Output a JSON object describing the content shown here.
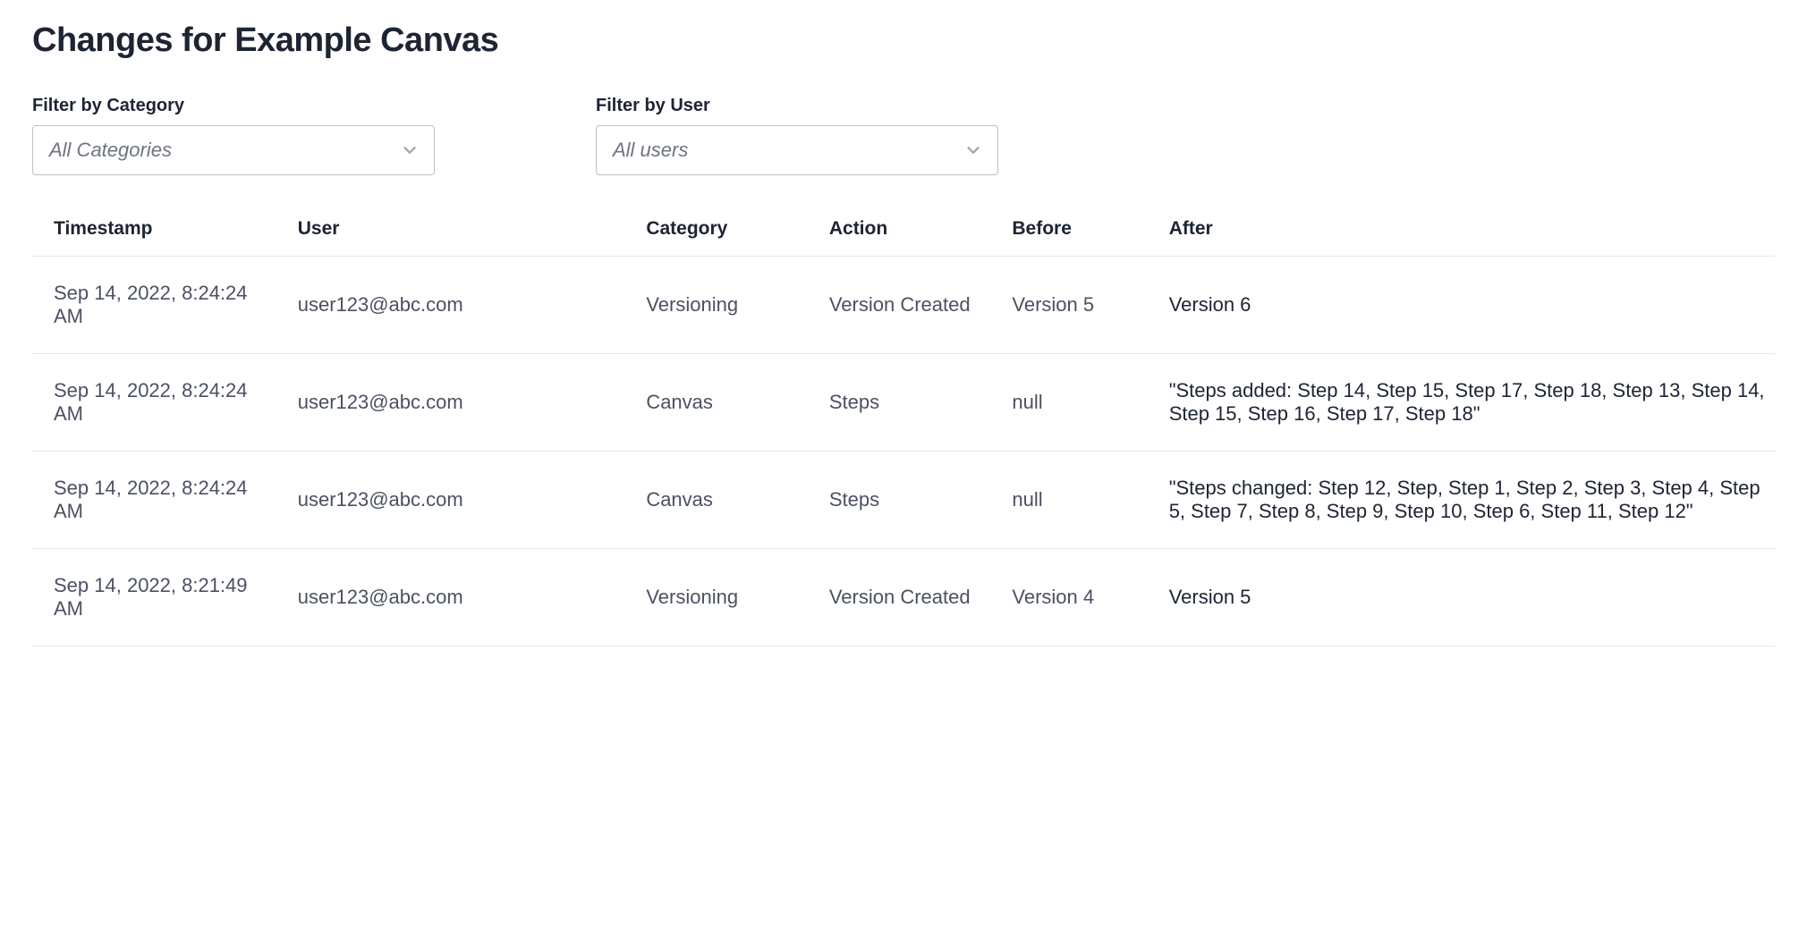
{
  "title": "Changes for Example Canvas",
  "filters": {
    "category": {
      "label": "Filter by Category",
      "placeholder": "All Categories"
    },
    "user": {
      "label": "Filter by User",
      "placeholder": "All users"
    }
  },
  "columns": {
    "timestamp": "Timestamp",
    "user": "User",
    "category": "Category",
    "action": "Action",
    "before": "Before",
    "after": "After"
  },
  "rows": [
    {
      "timestamp": "Sep 14, 2022, 8:24:24 AM",
      "user": "user123@abc.com",
      "category": "Versioning",
      "action": "Version Created",
      "before": "Version 5",
      "after": "Version 6"
    },
    {
      "timestamp": "Sep 14, 2022, 8:24:24 AM",
      "user": "user123@abc.com",
      "category": "Canvas",
      "action": "Steps",
      "before": "null",
      "after": "\"Steps added: Step 14, Step 15, Step 17, Step 18, Step 13, Step 14, Step 15, Step 16, Step 17, Step 18\""
    },
    {
      "timestamp": "Sep 14, 2022, 8:24:24 AM",
      "user": "user123@abc.com",
      "category": "Canvas",
      "action": "Steps",
      "before": "null",
      "after": "\"Steps changed: Step 12, Step, Step 1, Step 2, Step 3, Step 4, Step 5, Step 7, Step 8, Step 9, Step 10, Step 6, Step 11, Step 12\""
    },
    {
      "timestamp": "Sep 14, 2022, 8:21:49 AM",
      "user": "user123@abc.com",
      "category": "Versioning",
      "action": "Version Created",
      "before": "Version 4",
      "after": "Version 5"
    }
  ]
}
